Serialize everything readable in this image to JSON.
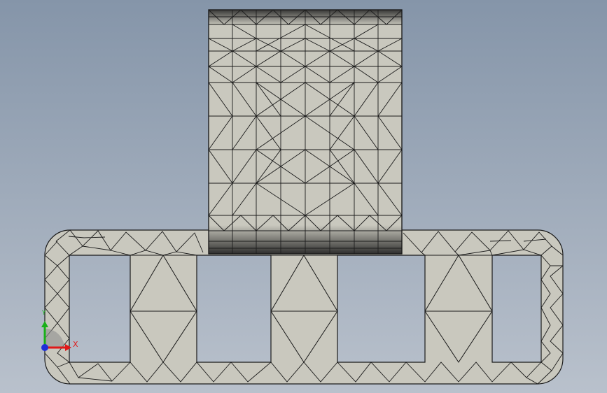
{
  "viewport": {
    "background_top": "#8595a9",
    "background_bottom": "#b9c1cc"
  },
  "model": {
    "face_color": "#c9c8be",
    "mesh_color": "#1a1a1a",
    "shade_color": "#2b2b2b"
  },
  "triad": {
    "x_label": "X",
    "y_label": "Y",
    "x_color": "#e01818",
    "y_color": "#19b019",
    "z_color": "#1f2fd8"
  }
}
